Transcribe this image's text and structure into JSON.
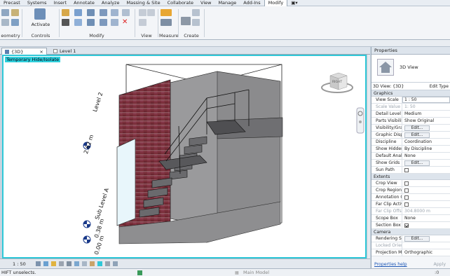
{
  "menu": [
    "Precast",
    "Systems",
    "Insert",
    "Annotate",
    "Analyze",
    "Massing & Site",
    "Collaborate",
    "View",
    "Manage",
    "Add-Ins",
    "Modify"
  ],
  "ribbon": {
    "groups": [
      "eometry",
      "Controls",
      "Modify",
      "View",
      "Measure",
      "Create"
    ],
    "activate_label": "Activate"
  },
  "tabs": [
    {
      "label": "{3D}",
      "close": "×"
    },
    {
      "label": "Level 1",
      "close": ""
    }
  ],
  "viewport": {
    "banner": "Temporary Hide/Isolate",
    "levels": [
      {
        "name": "Level 2",
        "elev": "2.62 m"
      },
      {
        "name": "Sub Level A",
        "elev": "0.38 m"
      },
      {
        "name": "",
        "elev": "0.00 m"
      }
    ],
    "viewcube_face": "RIGHT"
  },
  "viewbar": {
    "scale": "1 : 50"
  },
  "status": {
    "message": "HIFT unselects.",
    "model": "Main Model",
    "filter_count": ":0"
  },
  "properties": {
    "title": "Properties",
    "type_name": "3D View",
    "selector": "3D View: {3D}",
    "edit_type": "Edit Type",
    "sections": [
      {
        "name": "Graphics",
        "rows": [
          {
            "k": "View Scale",
            "v": "1 : 50",
            "kind": "input"
          },
          {
            "k": "Scale Value",
            "v": "1:  50",
            "kind": "dim"
          },
          {
            "k": "Detail Level",
            "v": "Medium"
          },
          {
            "k": "Parts Visibility",
            "v": "Show Original"
          },
          {
            "k": "Visibility/Grap...",
            "v": "Edit...",
            "kind": "button"
          },
          {
            "k": "Graphic Displa...",
            "v": "Edit...",
            "kind": "button"
          },
          {
            "k": "Discipline",
            "v": "Coordination"
          },
          {
            "k": "Show Hidden ...",
            "v": "By Discipline"
          },
          {
            "k": "Default Analysi...",
            "v": "None"
          },
          {
            "k": "Show Grids",
            "v": "Edit...",
            "kind": "button"
          },
          {
            "k": "Sun Path",
            "v": "",
            "kind": "check"
          }
        ]
      },
      {
        "name": "Extents",
        "rows": [
          {
            "k": "Crop View",
            "v": "",
            "kind": "check"
          },
          {
            "k": "Crop Region ...",
            "v": "",
            "kind": "check"
          },
          {
            "k": "Annotation Cr...",
            "v": "",
            "kind": "check"
          },
          {
            "k": "Far Clip Active",
            "v": "",
            "kind": "check"
          },
          {
            "k": "Far Clip Offset",
            "v": "304.8000 m",
            "kind": "dim"
          },
          {
            "k": "Scope Box",
            "v": "None"
          },
          {
            "k": "Section Box",
            "v": "",
            "kind": "checkon"
          }
        ]
      },
      {
        "name": "Camera",
        "rows": [
          {
            "k": "Rendering Set...",
            "v": "Edit...",
            "kind": "button"
          },
          {
            "k": "Locked Orient...",
            "v": "",
            "kind": "dim"
          },
          {
            "k": "Projection Mo...",
            "v": "Orthographic"
          }
        ]
      }
    ],
    "help_link": "Properties help",
    "apply": "Apply"
  }
}
